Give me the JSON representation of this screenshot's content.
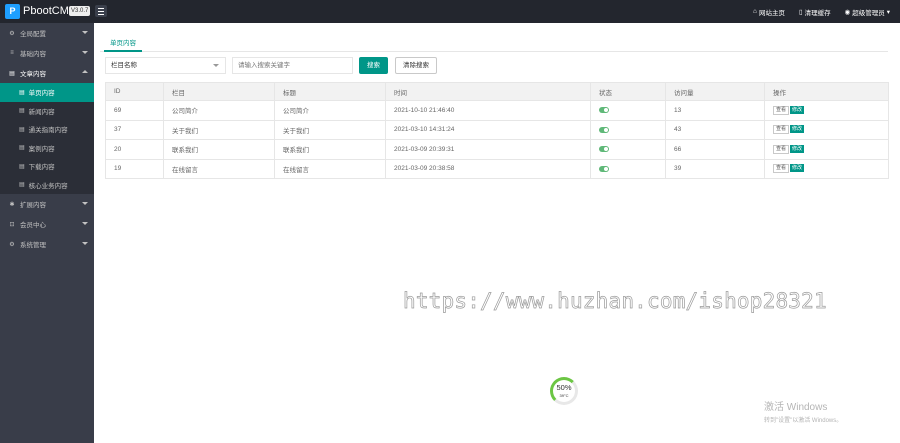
{
  "app": {
    "logo_letter": "P",
    "brand": "PbootCMS",
    "version": "V3.0.7"
  },
  "topbar": {
    "items": [
      {
        "icon": "home-icon",
        "glyph": "⌂",
        "label": "网站主页"
      },
      {
        "icon": "trash-icon",
        "glyph": "▯",
        "label": "清理缓存"
      },
      {
        "icon": "user-icon",
        "glyph": "◉",
        "label": "超级管理员"
      }
    ]
  },
  "sidebar": {
    "groups": [
      {
        "label": "全局配置",
        "icon": "gear-icon",
        "glyph": "⚙"
      },
      {
        "label": "基础内容",
        "icon": "sliders-icon",
        "glyph": "≡"
      },
      {
        "label": "文章内容",
        "icon": "file-icon",
        "glyph": "▤"
      },
      {
        "label": "扩展内容",
        "icon": "puzzle-icon",
        "glyph": "✱"
      },
      {
        "label": "会员中心",
        "icon": "lock-icon",
        "glyph": "⊡"
      },
      {
        "label": "系统管理",
        "icon": "gear-icon",
        "glyph": "⚙"
      }
    ],
    "sub_items": [
      {
        "label": "单页内容"
      },
      {
        "label": "新闻内容"
      },
      {
        "label": "通关指南内容"
      },
      {
        "label": "案例内容"
      },
      {
        "label": "下载内容"
      },
      {
        "label": "核心业务内容"
      }
    ]
  },
  "main": {
    "tab": "单页内容",
    "filter": {
      "select_value": "栏目名称",
      "search_placeholder": "请输入搜索关键字",
      "search_button": "搜索",
      "clear_button": "清除搜索"
    },
    "table": {
      "headers": [
        "ID",
        "栏目",
        "标题",
        "时间",
        "状态",
        "访问量",
        "操作"
      ],
      "rows": [
        {
          "id": "69",
          "column": "公司简介",
          "title": "公司简介",
          "time": "2021-10-10 21:46:40",
          "status": true,
          "visits": "13"
        },
        {
          "id": "37",
          "column": "关于我们",
          "title": "关于我们",
          "time": "2021-03-10 14:31:24",
          "status": true,
          "visits": "43"
        },
        {
          "id": "20",
          "column": "联系我们",
          "title": "联系我们",
          "time": "2021-03-09 20:39:31",
          "status": true,
          "visits": "66"
        },
        {
          "id": "19",
          "column": "在线留言",
          "title": "在线留言",
          "time": "2021-03-09 20:38:58",
          "status": true,
          "visits": "39"
        }
      ],
      "op_view": "查看",
      "op_edit": "修改"
    }
  },
  "overlays": {
    "watermark": "https://www.huzhan.com/ishop28321",
    "gauge_percent": "50%",
    "gauge_temp": "39°C",
    "windows_title": "激活 Windows",
    "windows_sub": "转到\"设置\"以激活 Windows。"
  },
  "colors": {
    "accent": "#009688",
    "sidebar_bg": "#393d49",
    "topbar_bg": "#23262e",
    "switch_on": "#5fb878"
  }
}
